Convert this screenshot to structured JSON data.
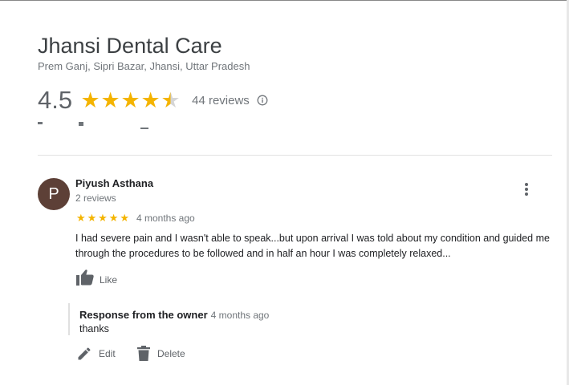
{
  "business": {
    "name": "Jhansi Dental Care",
    "address": "Prem Ganj, Sipri Bazar, Jhansi, Uttar Pradesh",
    "rating": "4.5",
    "rating_value": 4.5,
    "reviews_label": "44 reviews"
  },
  "review": {
    "avatar_letter": "P",
    "avatar_color": "#5d4037",
    "author": "Piyush Asthana",
    "author_meta": "2 reviews",
    "stars": 5,
    "time": "4 months ago",
    "text": "I had severe pain and I wasn't able to speak...but upon arrival I was told about my condition and guided me through the procedures to be followed and in half an hour I was completely relaxed...",
    "like_label": "Like"
  },
  "owner_response": {
    "title": "Response from the owner",
    "time": "4 months ago",
    "text": "thanks"
  },
  "actions": {
    "edit_label": "Edit",
    "delete_label": "Delete"
  },
  "colors": {
    "star": "#f4b400",
    "star_empty": "#d5d5d5",
    "text_secondary": "#70757a"
  },
  "icons": [
    "info-icon",
    "more-vert-icon",
    "thumb-up-icon",
    "edit-icon",
    "delete-icon"
  ]
}
